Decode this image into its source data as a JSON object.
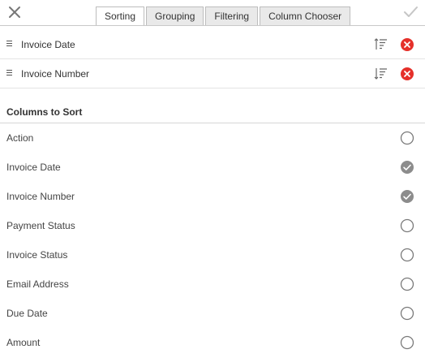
{
  "toolbar": {
    "close_icon": "close-icon",
    "confirm_icon": "checkmark-icon"
  },
  "tabs": [
    {
      "label": "Sorting",
      "active": true
    },
    {
      "label": "Grouping",
      "active": false
    },
    {
      "label": "Filtering",
      "active": false
    },
    {
      "label": "Column Chooser",
      "active": false
    }
  ],
  "sorted_columns": [
    {
      "label": "Invoice Date",
      "direction": "ascending"
    },
    {
      "label": "Invoice Number",
      "direction": "descending"
    }
  ],
  "section": {
    "title": "Columns to Sort"
  },
  "columns": [
    {
      "label": "Action",
      "selected": false
    },
    {
      "label": "Invoice Date",
      "selected": true
    },
    {
      "label": "Invoice Number",
      "selected": true
    },
    {
      "label": "Payment Status",
      "selected": false
    },
    {
      "label": "Invoice Status",
      "selected": false
    },
    {
      "label": "Email Address",
      "selected": false
    },
    {
      "label": "Due Date",
      "selected": false
    },
    {
      "label": "Amount",
      "selected": false
    }
  ],
  "colors": {
    "remove": "#e5302a",
    "checked": "#8c8c8c",
    "unchecked_border": "#7a7a7a",
    "tab_inactive": "#e9e9e9"
  }
}
